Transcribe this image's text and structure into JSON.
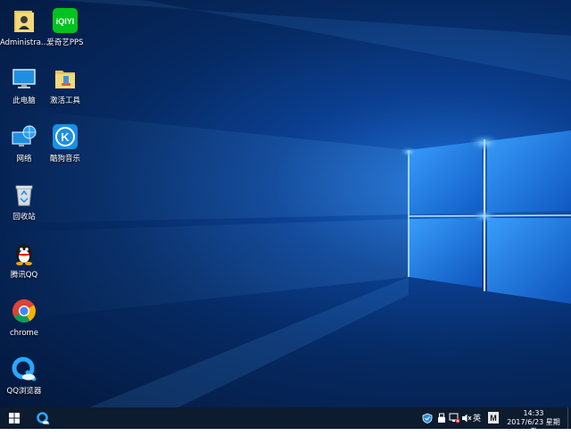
{
  "desktop": {
    "icons": [
      {
        "label": "Administra...",
        "icon": "user-folder-icon"
      },
      {
        "label": "爱奇艺PPS",
        "icon": "iqiyi-icon",
        "badge": "iQIYI"
      },
      {
        "label": "此电脑",
        "icon": "computer-icon"
      },
      {
        "label": "激活工具",
        "icon": "activation-tool-icon"
      },
      {
        "label": "网络",
        "icon": "network-icon"
      },
      {
        "label": "酷狗音乐",
        "icon": "kugou-icon",
        "badge": "K"
      },
      {
        "label": "回收站",
        "icon": "recycle-bin-icon"
      },
      {
        "label": "腾讯QQ",
        "icon": "qq-icon"
      },
      {
        "label": "chrome",
        "icon": "chrome-icon"
      },
      {
        "label": "QQ浏览器",
        "icon": "qq-browser-icon"
      }
    ]
  },
  "taskbar": {
    "ime": "英",
    "ime_mode": "M",
    "time": "14:33",
    "date": "2017/6/23 星期五"
  },
  "colors": {
    "taskbar": "#0d1b2e",
    "iqiyi_green": "#00c31f",
    "kugou_blue": "#1a8fe8"
  }
}
